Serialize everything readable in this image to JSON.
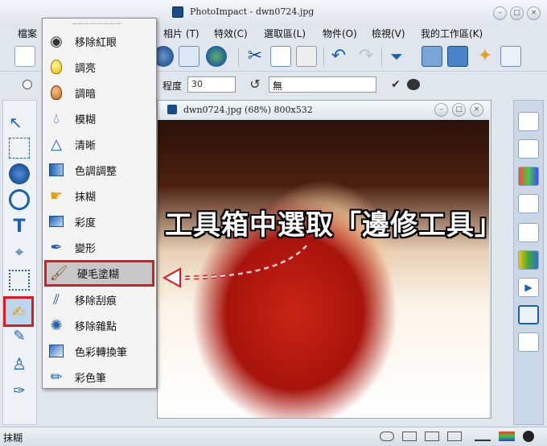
{
  "app": {
    "title": "PhotoImpact - dwn0724.jpg",
    "menus": [
      "檔案",
      "相片 (T)",
      "特效(C)",
      "選取區(L)",
      "物件(O)",
      "檢視(V)",
      "我的工作區(K)"
    ]
  },
  "attr_bar": {
    "degree_label": "程度",
    "degree_value": "30",
    "mode_value": "無"
  },
  "document": {
    "title": "dwn0724.jpg (68%) 800x532"
  },
  "popup_menu": {
    "items": [
      {
        "label": "移除紅眼",
        "icon": "eye-icon"
      },
      {
        "label": "調亮",
        "icon": "light-bulb-icon"
      },
      {
        "label": "調暗",
        "icon": "dark-bulb-icon"
      },
      {
        "label": "模糊",
        "icon": "water-drop-icon"
      },
      {
        "label": "清晰",
        "icon": "triangle-icon"
      },
      {
        "label": "色調調整",
        "icon": "color-tone-icon"
      },
      {
        "label": "抹糊",
        "icon": "smudge-icon"
      },
      {
        "label": "彩度",
        "icon": "saturation-icon"
      },
      {
        "label": "變形",
        "icon": "warp-icon"
      },
      {
        "label": "硬毛塗糊",
        "icon": "brush-icon",
        "selected": true
      },
      {
        "label": "移除刮痕",
        "icon": "scratch-remove-icon"
      },
      {
        "label": "移除雜點",
        "icon": "noise-remove-icon"
      },
      {
        "label": "色彩轉換筆",
        "icon": "color-replace-pen-icon"
      },
      {
        "label": "彩色筆",
        "icon": "color-pen-icon"
      }
    ]
  },
  "annotation": {
    "text": "工具箱中選取「邊修工具」"
  },
  "status": {
    "text": "抹糊"
  },
  "colors": {
    "highlight": "#e0171c",
    "panel": "#c9d7e6"
  }
}
